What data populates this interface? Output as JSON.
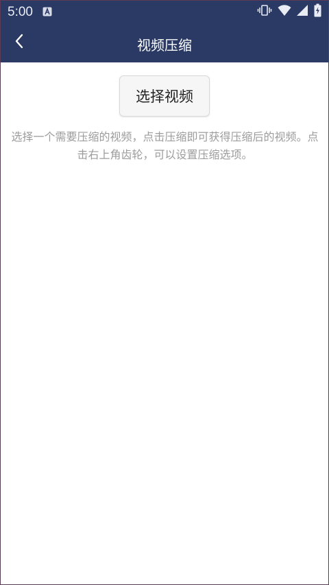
{
  "status_bar": {
    "time": "5:00",
    "icons": [
      "a-notification-icon",
      "vibrate-icon",
      "wifi-icon",
      "signal-icon",
      "battery-icon"
    ]
  },
  "app_bar": {
    "title": "视频压缩",
    "back_icon": "chevron-left-icon"
  },
  "main": {
    "select_button_label": "选择视频",
    "hint": "选择一个需要压缩的视频，点击压缩即可获得压缩后的视频。点击右上角齿轮，可以设置压缩选项。"
  },
  "colors": {
    "header_bg": "#2a3a64",
    "hint_text": "#9c9c9c"
  }
}
